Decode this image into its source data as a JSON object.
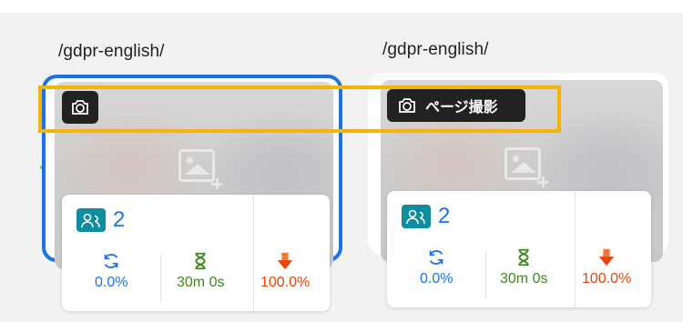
{
  "cards": [
    {
      "page_path": "/gdpr-english/",
      "selected": true,
      "camera_label": "",
      "users": "2",
      "refresh_rate": "0.0%",
      "avg_time": "30m 0s",
      "bounce_rate": "100.0%"
    },
    {
      "page_path": "/gdpr-english/",
      "selected": false,
      "camera_label": "ページ撮影",
      "users": "2",
      "refresh_rate": "0.0%",
      "avg_time": "30m 0s",
      "bounce_rate": "100.0%"
    }
  ],
  "icons": {
    "camera": "camera-icon",
    "users": "users-icon",
    "refresh": "refresh-icon",
    "hourglass": "hourglass-icon",
    "down_arrow": "down-arrow-icon",
    "placeholder": "image-placeholder-icon"
  },
  "colors": {
    "selected_border": "#1a73e8",
    "highlight": "#f4b400",
    "refresh": "#1a73e8",
    "time": "#3a8a1c",
    "bounce": "#e8440a",
    "users_badge": "#0e8ca0"
  }
}
